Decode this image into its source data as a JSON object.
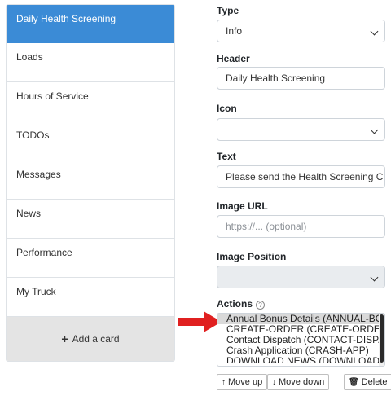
{
  "cards": {
    "items": [
      {
        "label": "Daily Health Screening",
        "active": true
      },
      {
        "label": "Loads"
      },
      {
        "label": "Hours of Service"
      },
      {
        "label": "TODOs"
      },
      {
        "label": "Messages"
      },
      {
        "label": "News"
      },
      {
        "label": "Performance"
      },
      {
        "label": "My Truck"
      }
    ],
    "add_label": "Add a card"
  },
  "form": {
    "type": {
      "label": "Type",
      "value": "Info"
    },
    "header": {
      "label": "Header",
      "value": "Daily Health Screening"
    },
    "icon": {
      "label": "Icon",
      "value": ""
    },
    "text": {
      "label": "Text",
      "value": "Please send the Health Screening Che"
    },
    "image_url": {
      "label": "Image URL",
      "placeholder": "https://... (optional)"
    },
    "image_position": {
      "label": "Image Position",
      "value": ""
    },
    "actions": {
      "label": "Actions",
      "options": [
        "Annual Bonus Details (ANNUAL-BONU",
        "CREATE-ORDER (CREATE-ORDER)",
        "Contact Dispatch (CONTACT-DISPATC",
        "Crash Application (CRASH-APP)",
        "DOWNLOAD NEWS (DOWNLOAD-NE"
      ],
      "selected_index": 0
    },
    "buttons": {
      "move_up": "Move up",
      "move_down": "Move down",
      "delete": "Delete"
    }
  },
  "colors": {
    "active_card": "#3b8bd6",
    "arrow": "#e02020",
    "add_card_bg": "#e4e4e4"
  }
}
